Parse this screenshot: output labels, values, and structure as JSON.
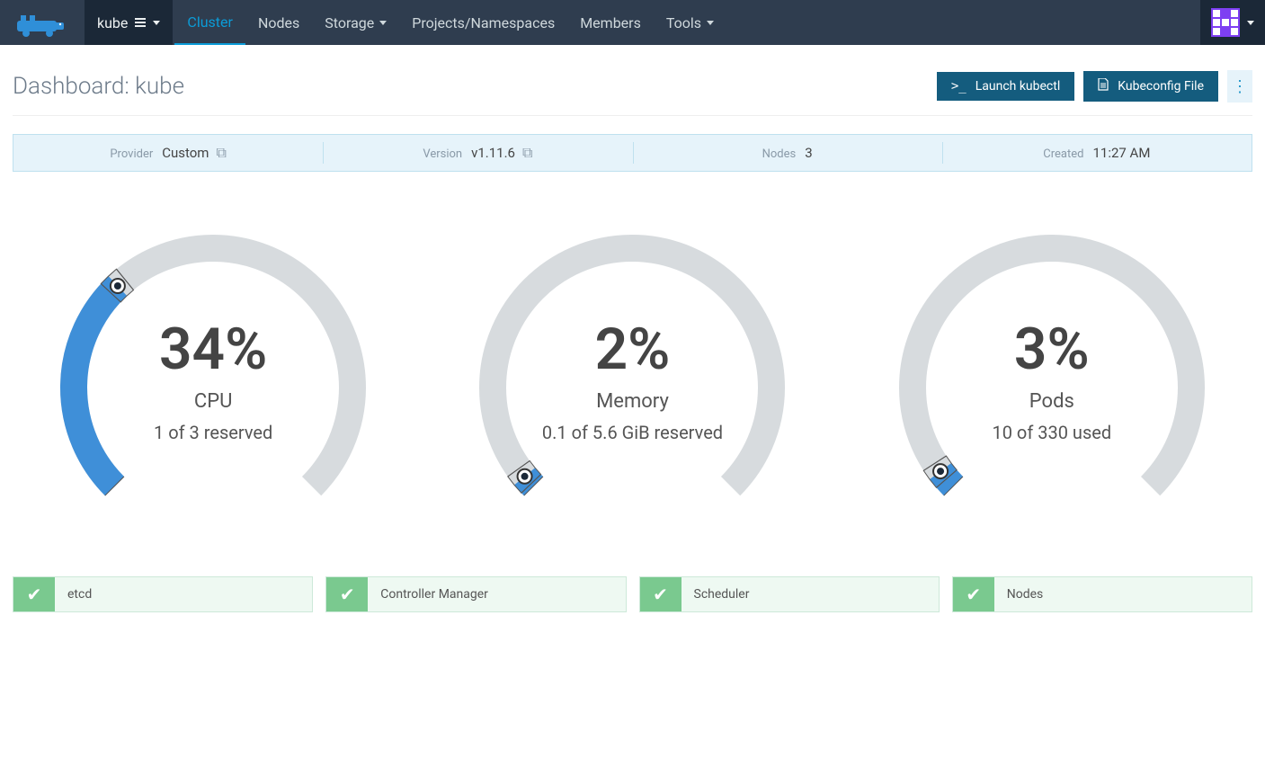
{
  "nav": {
    "cluster_name": "kube",
    "items": [
      {
        "label": "Cluster",
        "active": true,
        "dropdown": false
      },
      {
        "label": "Nodes",
        "active": false,
        "dropdown": false
      },
      {
        "label": "Storage",
        "active": false,
        "dropdown": true
      },
      {
        "label": "Projects/Namespaces",
        "active": false,
        "dropdown": false
      },
      {
        "label": "Members",
        "active": false,
        "dropdown": false
      },
      {
        "label": "Tools",
        "active": false,
        "dropdown": true
      }
    ]
  },
  "page_header": {
    "title_prefix": "Dashboard: ",
    "title_value": "kube",
    "launch_kubectl": "Launch kubectl",
    "kubeconfig_file": "Kubeconfig File"
  },
  "info_bar": {
    "provider_label": "Provider",
    "provider_value": "Custom",
    "version_label": "Version",
    "version_value": "v1.11.6",
    "nodes_label": "Nodes",
    "nodes_value": "3",
    "created_label": "Created",
    "created_value": "11:27 AM"
  },
  "gauges": [
    {
      "percent": "34%",
      "label": "CPU",
      "sub": "1 of 3 reserved",
      "value": 34
    },
    {
      "percent": "2%",
      "label": "Memory",
      "sub": "0.1 of 5.6 GiB reserved",
      "value": 2
    },
    {
      "percent": "3%",
      "label": "Pods",
      "sub": "10 of 330 used",
      "value": 3
    }
  ],
  "statuses": [
    {
      "label": "etcd"
    },
    {
      "label": "Controller Manager"
    },
    {
      "label": "Scheduler"
    },
    {
      "label": "Nodes"
    }
  ],
  "chart_data": [
    {
      "type": "gauge",
      "title": "CPU",
      "value": 34,
      "unit": "%",
      "sub": "1 of 3 reserved",
      "range": [
        0,
        100
      ]
    },
    {
      "type": "gauge",
      "title": "Memory",
      "value": 2,
      "unit": "%",
      "sub": "0.1 of 5.6 GiB reserved",
      "range": [
        0,
        100
      ]
    },
    {
      "type": "gauge",
      "title": "Pods",
      "value": 3,
      "unit": "%",
      "sub": "10 of 330 used",
      "range": [
        0,
        100
      ]
    }
  ]
}
